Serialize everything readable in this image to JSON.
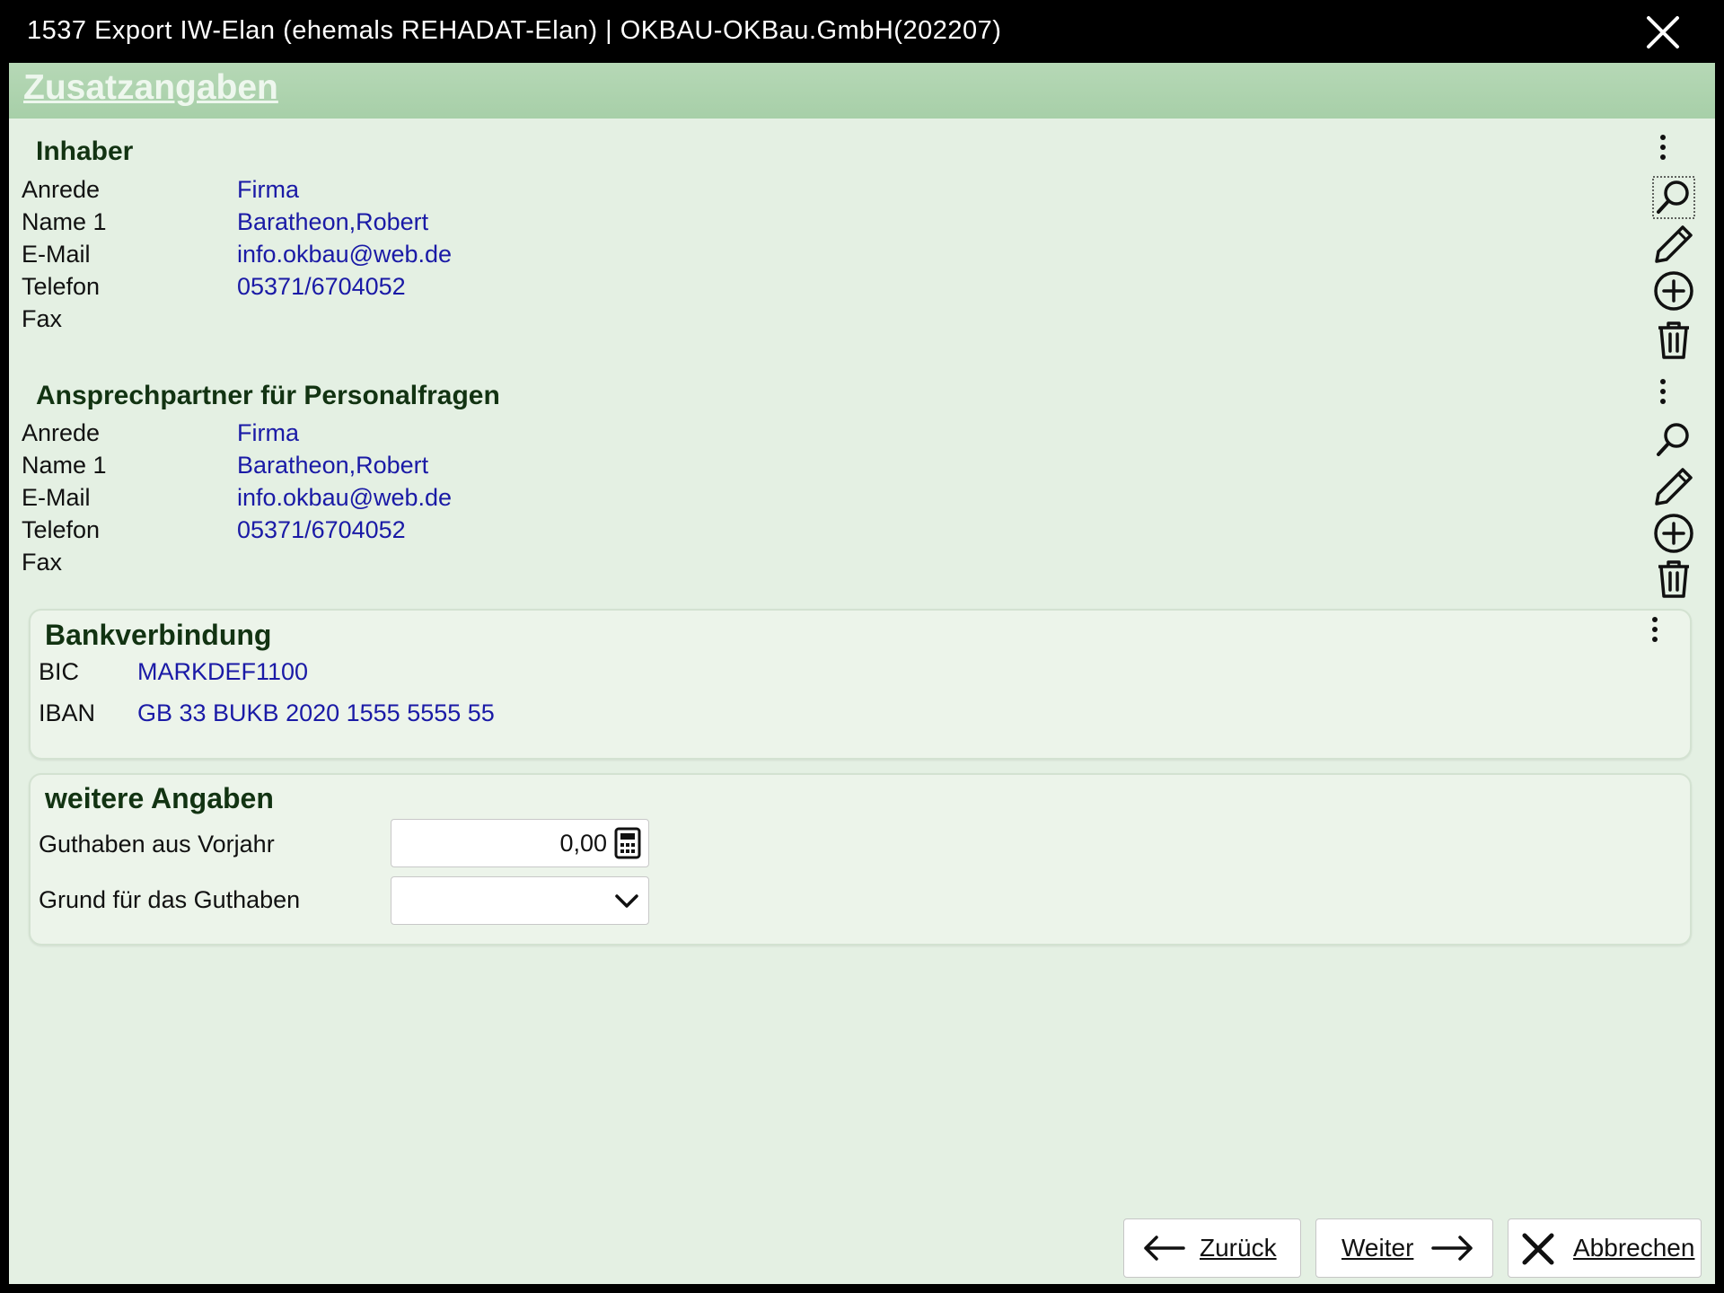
{
  "window": {
    "title": "1537 Export IW-Elan (ehemals REHADAT-Elan) | OKBAU-OKBau.GmbH(202207)"
  },
  "header": {
    "title": "Zusatzangaben"
  },
  "inhaber": {
    "title": "Inhaber",
    "labels": {
      "anrede": "Anrede",
      "name1": "Name 1",
      "email": "E-Mail",
      "telefon": "Telefon",
      "fax": "Fax"
    },
    "values": {
      "anrede": "Firma",
      "name1": "Baratheon,Robert",
      "email": "info.okbau@web.de",
      "telefon": "05371/6704052",
      "fax": ""
    }
  },
  "ansprechpartner": {
    "title": "Ansprechpartner für Personalfragen",
    "labels": {
      "anrede": "Anrede",
      "name1": "Name 1",
      "email": "E-Mail",
      "telefon": "Telefon",
      "fax": "Fax"
    },
    "values": {
      "anrede": "Firma",
      "name1": "Baratheon,Robert",
      "email": "info.okbau@web.de",
      "telefon": "05371/6704052",
      "fax": ""
    }
  },
  "bank": {
    "title": "Bankverbindung",
    "bic_label": "BIC",
    "bic_value": "MARKDEF1100",
    "iban_label": "IBAN",
    "iban_value": "GB 33 BUKB 2020 1555 5555 55"
  },
  "weitere": {
    "title": "weitere Angaben",
    "guthaben_label": "Guthaben aus Vorjahr",
    "guthaben_value": "0,00",
    "grund_label": "Grund für das Guthaben",
    "grund_value": ""
  },
  "buttons": {
    "back": "Zurück",
    "next": "Weiter",
    "cancel": "Abbrechen"
  },
  "icons": [
    "close-icon",
    "search-icon",
    "pencil-icon",
    "plus-circle-icon",
    "trash-icon",
    "kebab-menu-icon",
    "calculator-icon",
    "chevron-down-icon",
    "arrow-left-icon",
    "arrow-right-icon"
  ]
}
